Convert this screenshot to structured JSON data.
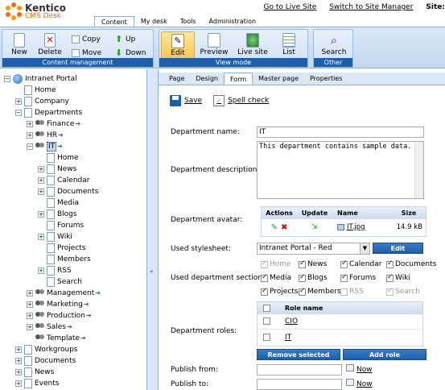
{
  "app": {
    "brand_name": "Kentico",
    "brand_sub": "CMS Desk",
    "site_label": "Site:"
  },
  "top_links": [
    "Go to Live Site",
    "Switch to Site Manager"
  ],
  "main_tabs": [
    "Content",
    "My desk",
    "Tools",
    "Administration"
  ],
  "ribbon": {
    "content_management": {
      "label": "Content management",
      "new": "New",
      "delete": "Delete",
      "copy": "Copy",
      "move": "Move",
      "up": "Up",
      "down": "Down"
    },
    "view_mode": {
      "label": "View mode",
      "edit": "Edit",
      "preview": "Preview",
      "live_site": "Live site",
      "list": "List"
    },
    "other": {
      "label": "Other",
      "search": "Search"
    }
  },
  "tree": {
    "root": "Intranet Portal",
    "items": [
      {
        "label": "Home"
      },
      {
        "label": "Company"
      },
      {
        "label": "Departments"
      },
      {
        "label": "Finance"
      },
      {
        "label": "HR"
      },
      {
        "label": "IT"
      },
      {
        "label": "Home"
      },
      {
        "label": "News"
      },
      {
        "label": "Calendar"
      },
      {
        "label": "Documents"
      },
      {
        "label": "Media"
      },
      {
        "label": "Blogs"
      },
      {
        "label": "Forums"
      },
      {
        "label": "Wiki"
      },
      {
        "label": "Projects"
      },
      {
        "label": "Members"
      },
      {
        "label": "RSS"
      },
      {
        "label": "Search"
      },
      {
        "label": "Management"
      },
      {
        "label": "Marketing"
      },
      {
        "label": "Production"
      },
      {
        "label": "Sales"
      },
      {
        "label": "Template"
      },
      {
        "label": "Workgroups"
      },
      {
        "label": "Documents"
      },
      {
        "label": "News"
      },
      {
        "label": "Events"
      }
    ]
  },
  "sub_tabs": [
    "Page",
    "Design",
    "Form",
    "Master page",
    "Properties"
  ],
  "toolbar": {
    "save": "Save",
    "spell_check": "Spell check"
  },
  "form": {
    "dept_name_label": "Department name:",
    "dept_name_value": "IT",
    "dept_desc_label": "Department description:",
    "dept_desc_value": "This department contains sample data.",
    "avatar_label": "Department avatar:",
    "avatar_grid": {
      "headers": [
        "Actions",
        "Update",
        "Name",
        "Size"
      ],
      "file_name": "IT.jpg",
      "file_size": "14.9 kB"
    },
    "stylesheet_label": "Used stylesheet:",
    "stylesheet_value": "Intranet Portal - Red",
    "stylesheet_edit": "Edit",
    "sections_label": "Used department sections:",
    "sections": [
      {
        "label": "Home",
        "checked": true,
        "disabled": true
      },
      {
        "label": "News",
        "checked": true,
        "disabled": false
      },
      {
        "label": "Calendar",
        "checked": true,
        "disabled": false
      },
      {
        "label": "Documents",
        "checked": true,
        "disabled": false
      },
      {
        "label": "Media",
        "checked": true,
        "disabled": false
      },
      {
        "label": "Blogs",
        "checked": true,
        "disabled": false
      },
      {
        "label": "Forums",
        "checked": true,
        "disabled": false
      },
      {
        "label": "Wiki",
        "checked": true,
        "disabled": false
      },
      {
        "label": "Projects",
        "checked": true,
        "disabled": false
      },
      {
        "label": "Members",
        "checked": true,
        "disabled": false
      },
      {
        "label": "RSS",
        "checked": false,
        "disabled": true
      },
      {
        "label": "Search",
        "checked": true,
        "disabled": true
      }
    ],
    "roles_label": "Department roles:",
    "roles_header": "Role name",
    "roles": [
      "CIO",
      "IT"
    ],
    "remove_selected": "Remove selected",
    "add_role": "Add role",
    "publish_from_label": "Publish from:",
    "publish_to_label": "Publish to:",
    "now": "Now"
  },
  "colors": {
    "accent": "#1f5fa8",
    "ribbon_bg": "#cfe0f4",
    "selected": "#f8c75a",
    "brand_orange": "#ff6600"
  }
}
